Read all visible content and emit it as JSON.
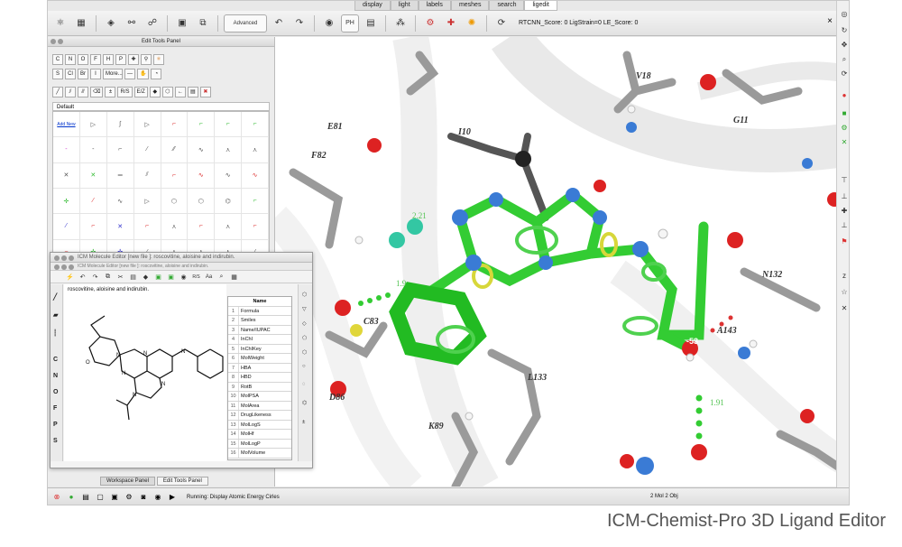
{
  "top_tabs": [
    "display",
    "light",
    "labels",
    "meshes",
    "search",
    "ligedit"
  ],
  "active_tab": "ligedit",
  "toolbar": {
    "advanced_label": "Advanced",
    "ph_label": "PH",
    "score_text": "RTCNN_Score: 0 LigStrain=0 LE_Score: 0",
    "close_label": "×"
  },
  "edit_tools_panel": {
    "title": "Edit Tools Panel",
    "element_buttons_row1": [
      "C",
      "N",
      "O",
      "F",
      "H",
      "P"
    ],
    "element_buttons_row2": [
      "S",
      "Cl",
      "Br",
      "I",
      "More..."
    ],
    "tool_row3": [
      "R/S",
      "E/Z"
    ],
    "library_title": "Default",
    "add_new_label": "Add New"
  },
  "molecule_editor": {
    "title": "ICM Molecule Editor [new file ]: roscovitine, aloisine and indirubin.",
    "subtitle": "ICM Molecule Editor [new file ]: roscovitine, aloisine and indirubin.",
    "canvas_text": "roscovitine, aloisine and indirubin.",
    "left_elements": [
      "C",
      "N",
      "O",
      "F",
      "P",
      "S"
    ],
    "tool_rs": "R/S",
    "tool_aa": "Aa",
    "properties_header": "Name",
    "properties": [
      "Formula",
      "Smiles",
      "Name/IUPAC",
      "InChI",
      "InChIKey",
      "MolWeight",
      "HBA",
      "HBD",
      "RotB",
      "MolPSA",
      "MolArea",
      "DrugLikeness",
      "MolLogS",
      "MolHf",
      "MolLogP",
      "MolVolume"
    ],
    "property_numbers": [
      "1",
      "2",
      "3",
      "4",
      "5",
      "6",
      "7",
      "8",
      "9",
      "10",
      "11",
      "12",
      "13",
      "14",
      "15",
      "16"
    ]
  },
  "residue_labels": [
    "V18",
    "G11",
    "E81",
    "F82",
    "I10",
    "C83",
    "L133",
    "A143",
    "N132",
    "K89",
    "D86"
  ],
  "distance_labels": [
    "2.21",
    "1.9",
    "1.91",
    "-53"
  ],
  "bottom_tabs": [
    "Workspace Panel",
    "Edit Tools Panel"
  ],
  "active_bottom_tab": "Edit Tools Panel",
  "status": {
    "running_text": "Running: Display Atomic Energy Cirles",
    "count_text": "2 Mol 2 Obj"
  },
  "caption": "ICM-Chemist-Pro 3D Ligand Editor",
  "colors": {
    "ligand_green": "#33cc33",
    "nitrogen_blue": "#3a7bd5",
    "oxygen_red": "#dd2222",
    "carbon_gray": "#9a9a9a",
    "ribbon_white": "#eeeeee"
  }
}
